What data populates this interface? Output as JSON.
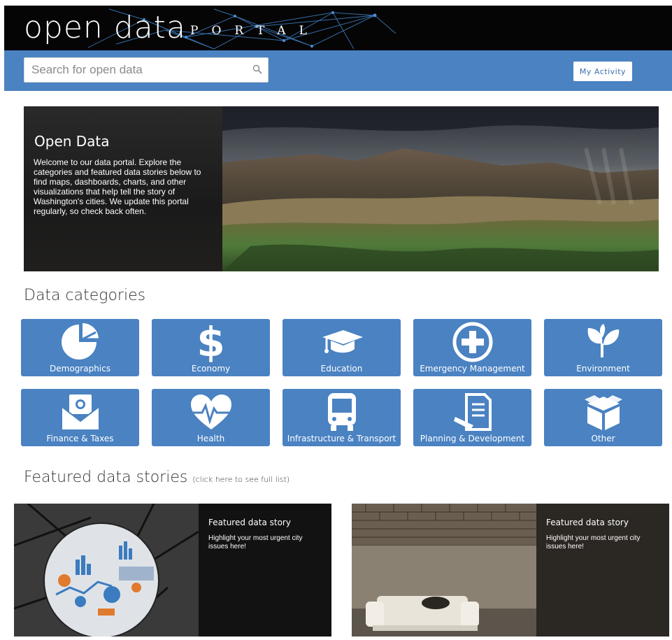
{
  "header": {
    "logo_main": "open data",
    "logo_sub": "PORTAL"
  },
  "search": {
    "placeholder": "Search for open data"
  },
  "actions": {
    "my_activity": "My Activity"
  },
  "hero": {
    "title": "Open Data",
    "text": "Welcome to our data portal. Explore the categories and featured data stories below to find maps, dashboards, charts, and other visualizations that help tell the story of Washington's cities. We update this portal regularly, so check back often."
  },
  "categories": {
    "title": "Data categories",
    "items": [
      {
        "label": "Demographics",
        "icon": "pie-chart-icon"
      },
      {
        "label": "Economy",
        "icon": "dollar-icon"
      },
      {
        "label": "Education",
        "icon": "graduation-cap-icon"
      },
      {
        "label": "Emergency Management",
        "icon": "medical-cross-icon"
      },
      {
        "label": "Environment",
        "icon": "leaf-sprout-icon"
      },
      {
        "label": "Finance & Taxes",
        "icon": "money-envelope-icon"
      },
      {
        "label": "Health",
        "icon": "heartbeat-icon"
      },
      {
        "label": "Infrastructure & Transport",
        "icon": "bus-icon"
      },
      {
        "label": "Planning & Development",
        "icon": "document-pen-icon"
      },
      {
        "label": "Other",
        "icon": "box-icon"
      }
    ]
  },
  "featured": {
    "title": "Featured data stories",
    "link": "(click here to see full list)",
    "stories": [
      {
        "title": "Featured data story",
        "text": "Highlight your most urgent city issues here!"
      },
      {
        "title": "Featured data story",
        "text": "Highlight your most urgent city issues here!"
      }
    ]
  },
  "colors": {
    "brand_blue": "#4a82c2",
    "header_black": "#050505",
    "story_panel": "#121212"
  }
}
